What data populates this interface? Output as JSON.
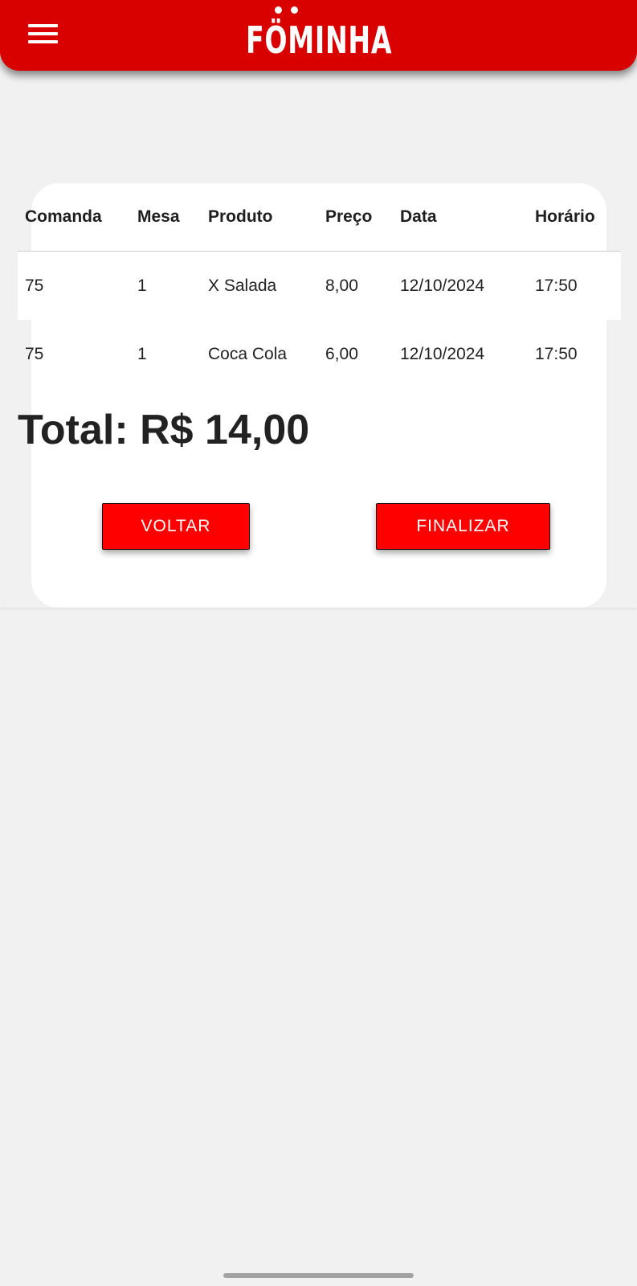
{
  "header": {
    "menu_icon": "menu-icon",
    "logo_text": "FÖMINHA",
    "background_color": "#d90000"
  },
  "table": {
    "columns": [
      "Comanda",
      "Mesa",
      "Produto",
      "Preço",
      "Data",
      "Horário"
    ],
    "rows": [
      [
        "75",
        "1",
        "X Salada",
        "8,00",
        "12/10/2024",
        "17:50"
      ],
      [
        "75",
        "1",
        "Coca Cola",
        "6,00",
        "12/10/2024",
        "17:50"
      ]
    ]
  },
  "total_label": "Total: R$ 14,00",
  "buttons": {
    "back_label": "VOLTAR",
    "finish_label": "FINALIZAR",
    "color": "#ff0000"
  }
}
